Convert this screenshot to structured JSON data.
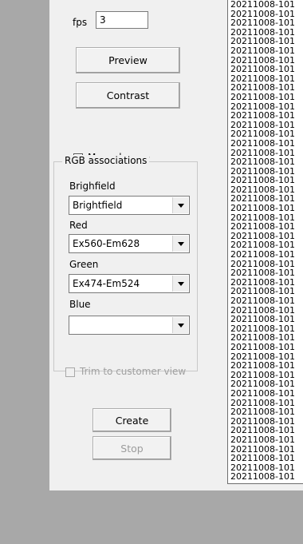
{
  "fps": {
    "label": "fps",
    "value": "3"
  },
  "buttons": {
    "preview": "Preview",
    "contrast": "Contrast",
    "create": "Create",
    "stop": "Stop"
  },
  "monochrome": {
    "label": "Monochrome",
    "checked": false
  },
  "rgb": {
    "title": "RGB associations",
    "brightfield": {
      "label": "Brighfield",
      "value": "Brightfield"
    },
    "red": {
      "label": "Red",
      "value": "Ex560-Em628"
    },
    "green": {
      "label": "Green",
      "value": "Ex474-Em524"
    },
    "blue": {
      "label": "Blue",
      "value": ""
    }
  },
  "trim": {
    "label": "Trim to customer view",
    "checked": false,
    "enabled": false
  },
  "file_list": {
    "item_text": "20211008-101",
    "count": 52
  }
}
